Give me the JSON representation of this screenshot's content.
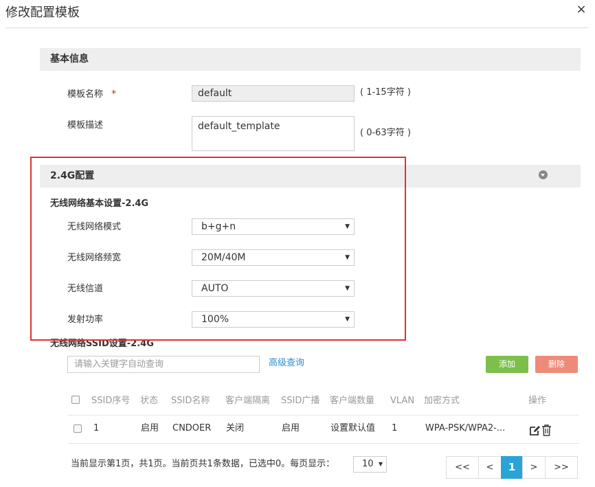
{
  "dialog": {
    "title": "修改配置模板",
    "close_symbol": "×"
  },
  "basic_info": {
    "header": "基本信息",
    "template_name_label": "模板名称",
    "required_mark": "*",
    "template_name_value": "default",
    "template_name_hint": "( 1-15字符 )",
    "template_desc_label": "模板描述",
    "template_desc_value": "default_template",
    "template_desc_hint": "( 0-63字符 )"
  },
  "config_24g": {
    "header": "2.4G配置",
    "subheading": "无线网络基本设置-2.4G",
    "mode_label": "无线网络模式",
    "mode_value": "b+g+n",
    "bandwidth_label": "无线网络频宽",
    "bandwidth_value": "20M/40M",
    "channel_label": "无线信道",
    "channel_value": "AUTO",
    "power_label": "发射功率",
    "power_value": "100%",
    "caret": "▼"
  },
  "ssid": {
    "heading": "无线网络SSID设置-2.4G",
    "search_placeholder": "请输入关键字自动查询",
    "advanced_search": "高级查询",
    "add_button": "添加",
    "delete_button": "删除",
    "columns": [
      "SSID序号",
      "状态",
      "SSID名称",
      "客户端隔离",
      "SSID广播",
      "客户端数量",
      "VLAN",
      "加密方式",
      "操作"
    ],
    "rows": [
      [
        "1",
        "启用",
        "CNDOER",
        "关闭",
        "启用",
        "设置默认值",
        "1",
        "WPA-PSK/WPA2-..."
      ]
    ]
  },
  "pagination": {
    "info": "当前显示第1页，共1页。当前页共1条数据，已选中0。每页显示：",
    "page_size": "10",
    "first": "<<",
    "prev": "<",
    "current": "1",
    "next": ">",
    "last": ">>"
  },
  "colors": {
    "add_button": "#7cbf4a",
    "delete_button": "#f08a78",
    "highlight_border": "#e03030",
    "active_page": "#2aa4d4",
    "link": "#2a8fd0",
    "required": "#e02020"
  }
}
